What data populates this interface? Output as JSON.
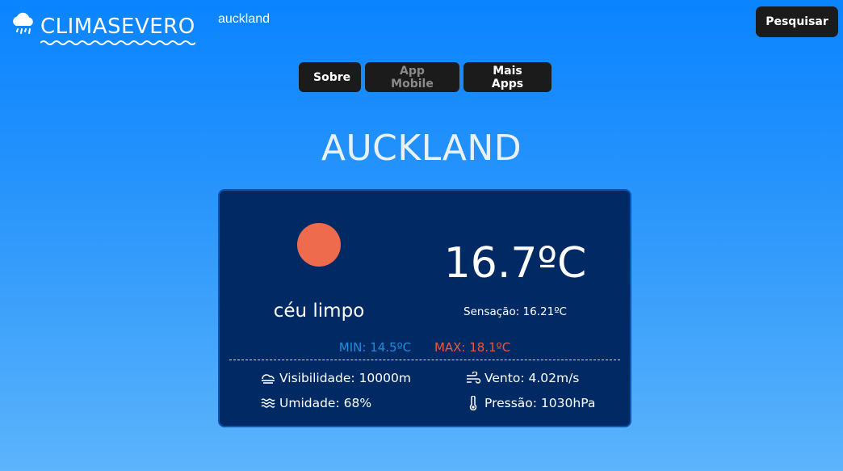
{
  "header": {
    "logo_text": "CLIMASEVERO",
    "search_value": "auckland",
    "search_button": "Pesquisar"
  },
  "nav": {
    "items": [
      {
        "label": "Sobre",
        "enabled": true
      },
      {
        "label": "App Mobile",
        "enabled": false
      },
      {
        "label": "Mais Apps",
        "enabled": true
      }
    ]
  },
  "weather": {
    "city": "AUCKLAND",
    "icon": "sun-icon",
    "description": "céu limpo",
    "temperature": "16.7ºC",
    "feels_like": "Sensação: 16.21ºC",
    "min": "MIN: 14.5ºC",
    "max": "MAX: 18.1ºC",
    "visibility": "Visibilidade: 10000m",
    "humidity": "Umidade: 68%",
    "wind": "Vento: 4.02m/s",
    "pressure": "Pressão: 1030hPa"
  },
  "colors": {
    "card_background": "#012a64",
    "sun": "#ee6b4d",
    "min": "#1e8ddc",
    "max": "#ea5a3b",
    "button": "#1b1b1b"
  }
}
